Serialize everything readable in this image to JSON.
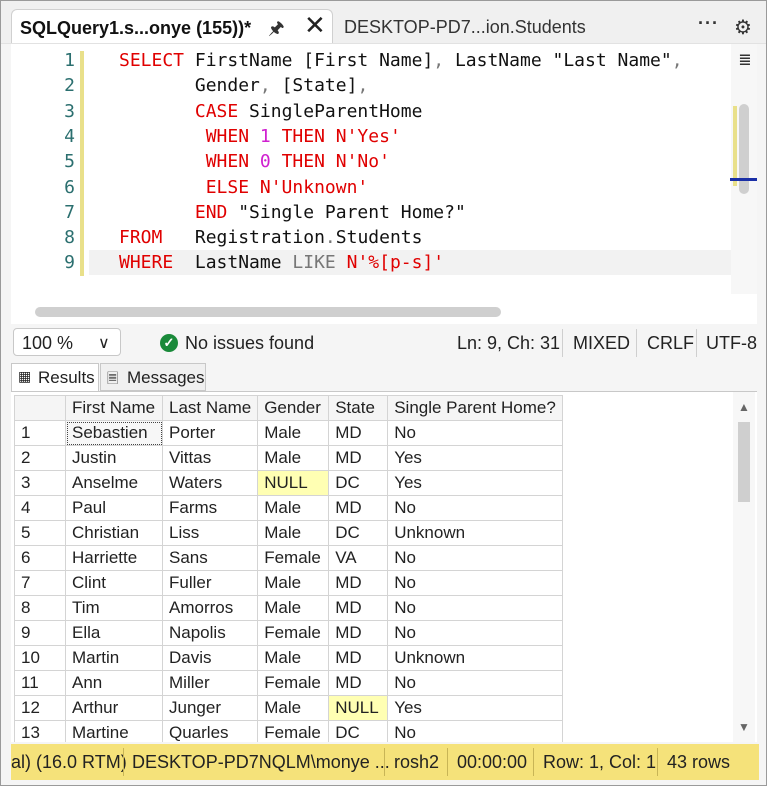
{
  "tabs": {
    "active_title": "SQLQuery1.s...onye (155))*",
    "inactive_title": "DESKTOP-PD7...ion.Students",
    "more_label": "···",
    "settings_icon": "gear-icon",
    "pin_icon": "pin-icon",
    "close_icon": "close-icon"
  },
  "editor": {
    "line_numbers": [
      "1",
      "2",
      "3",
      "4",
      "5",
      "6",
      "7",
      "8",
      "9"
    ],
    "lines": [
      [
        {
          "t": "SELECT",
          "c": "kw"
        },
        {
          "t": " FirstName [First Name]",
          "c": "id"
        },
        {
          "t": ",",
          "c": "op"
        },
        {
          "t": " LastName \"Last Name\"",
          "c": "id"
        },
        {
          "t": ",",
          "c": "op"
        }
      ],
      [
        {
          "t": "       Gender",
          "c": "id"
        },
        {
          "t": ",",
          "c": "op"
        },
        {
          "t": " [State]",
          "c": "id"
        },
        {
          "t": ",",
          "c": "op"
        }
      ],
      [
        {
          "t": "       CASE",
          "c": "kw"
        },
        {
          "t": " SingleParentHome",
          "c": "id"
        }
      ],
      [
        {
          "t": "        WHEN ",
          "c": "kw"
        },
        {
          "t": "1",
          "c": "num"
        },
        {
          "t": " THEN N'Yes'",
          "c": "kw"
        }
      ],
      [
        {
          "t": "        WHEN ",
          "c": "kw"
        },
        {
          "t": "0",
          "c": "num"
        },
        {
          "t": " THEN N'No'",
          "c": "kw"
        }
      ],
      [
        {
          "t": "        ELSE N'Unknown'",
          "c": "kw"
        }
      ],
      [
        {
          "t": "       END",
          "c": "kw"
        },
        {
          "t": " \"Single Parent Home?\"",
          "c": "id"
        }
      ],
      [
        {
          "t": "FROM",
          "c": "kw"
        },
        {
          "t": "   Registration",
          "c": "id"
        },
        {
          "t": ".",
          "c": "op"
        },
        {
          "t": "Students",
          "c": "id"
        }
      ],
      [
        {
          "t": "WHERE",
          "c": "kw"
        },
        {
          "t": "  LastName ",
          "c": "id"
        },
        {
          "t": "LIKE",
          "c": "op"
        },
        {
          "t": " N'%[p-s]'",
          "c": "str"
        }
      ]
    ]
  },
  "status": {
    "zoom": "100 %",
    "issues": "No issues found",
    "position": "Ln: 9, Ch: 31",
    "tabs_mode": "MIXED",
    "line_ending": "CRLF",
    "encoding": "UTF-8"
  },
  "result_tabs": {
    "results": "Results",
    "messages": "Messages"
  },
  "grid": {
    "columns": [
      "First Name",
      "Last Name",
      "Gender",
      "State",
      "Single Parent Home?"
    ],
    "rows": [
      [
        "1",
        "Sebastien",
        "Porter",
        "Male",
        "MD",
        "No"
      ],
      [
        "2",
        "Justin",
        "Vittas",
        "Male",
        "MD",
        "Yes"
      ],
      [
        "3",
        "Anselme",
        "Waters",
        "NULL",
        "DC",
        "Yes"
      ],
      [
        "4",
        "Paul",
        "Farms",
        "Male",
        "MD",
        "No"
      ],
      [
        "5",
        "Christian",
        "Liss",
        "Male",
        "DC",
        "Unknown"
      ],
      [
        "6",
        "Harriette",
        "Sans",
        "Female",
        "VA",
        "No"
      ],
      [
        "7",
        "Clint",
        "Fuller",
        "Male",
        "MD",
        "No"
      ],
      [
        "8",
        "Tim",
        "Amorros",
        "Male",
        "MD",
        "No"
      ],
      [
        "9",
        "Ella",
        "Napolis",
        "Female",
        "MD",
        "No"
      ],
      [
        "10",
        "Martin",
        "Davis",
        "Male",
        "MD",
        "Unknown"
      ],
      [
        "11",
        "Ann",
        "Miller",
        "Female",
        "MD",
        "No"
      ],
      [
        "12",
        "Arthur",
        "Junger",
        "Male",
        "NULL",
        "Yes"
      ],
      [
        "13",
        "Martine",
        "Quarles",
        "Female",
        "DC",
        "No"
      ]
    ]
  },
  "bottom_bar": {
    "server_version": "al) (16.0 RTM)",
    "connection": "DESKTOP-PD7NQLM\\monye ...",
    "database": "rosh2",
    "elapsed": "00:00:00",
    "row_col": "Row: 1, Col: 1",
    "row_count": "43 rows",
    "accent_color": "#f5e27a"
  }
}
